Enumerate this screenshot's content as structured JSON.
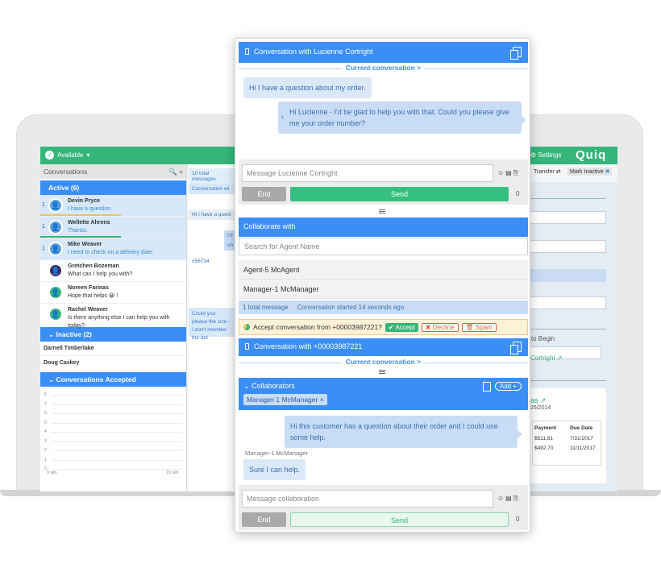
{
  "app": {
    "status": "Available",
    "settings": "Settings",
    "logo": "Quiq"
  },
  "left": {
    "conversations_title": "Conversations",
    "active_label": "Active (6)",
    "active": [
      {
        "num": "1",
        "name": "Devin Pryce",
        "msg": "I have a question",
        "style": "blue",
        "bar": "#f0c060"
      },
      {
        "num": "1",
        "name": "Wellette Ahrens",
        "msg": "Thanks.",
        "style": "blue",
        "bar": "#34b67a"
      },
      {
        "num": "1",
        "name": "Mike Weaver",
        "msg": "I need to check on a delivery date.",
        "style": "blue",
        "bar": ""
      },
      {
        "num": "",
        "name": "Gretchen Bozeman",
        "msg": "What can I help you with?",
        "style": "white",
        "bar": ""
      },
      {
        "num": "",
        "name": "Noreen Farinas",
        "msg": "Hope that helps 😀 !",
        "style": "white",
        "bar": ""
      },
      {
        "num": "",
        "name": "Rachel Weaver",
        "msg": "Is there anything else I can help you with today?",
        "style": "white",
        "bar": ""
      }
    ],
    "inactive_label": "Inactive (2)",
    "inactive": [
      "Darnell Timberlake",
      "Doug Caskey"
    ],
    "accepted_label": "Conversations Accepted",
    "chart_y": [
      "8",
      "7",
      "6",
      "5",
      "4",
      "3",
      "2",
      "1",
      "0"
    ],
    "chart_x": [
      "9 am",
      "10 am"
    ]
  },
  "mid": {
    "total": "10 total messages",
    "conv_with": "Conversation wi",
    "msg1": "Hi I have a quest",
    "msg2": "I'd",
    "msg3": "on",
    "order": "#56734",
    "msg4": "Could you please the size - I don't member the det"
  },
  "right": {
    "transfer": "Transfer",
    "mark_inactive": "Mark Inactive",
    "to_begin": "r to Begin",
    "cortright": "Cortright",
    "name_frag": "ias",
    "date_frag": "/25/2014",
    "payment_head": "Payment",
    "due_head": "Due Date",
    "rows": [
      [
        "$511.81",
        "7/31/2017"
      ],
      [
        "$492.70",
        "11/11/2017"
      ]
    ]
  },
  "widget": {
    "title": "Conversation with Lucienne Cortright",
    "current_conversation": "Current conversation >",
    "msg_customer": "Hi I have a question about my order.",
    "msg_agent": "Hi Lucienne - I'd be glad to help you with that. Could you please give me your order number?",
    "input_placeholder": "Message Lucienne Cortright",
    "end": "End",
    "send": "Send",
    "count": "0",
    "collaborate_with": "Collaborate with",
    "search_placeholder": "Search for Agent Name",
    "agents": [
      "Agent-5 McAgent",
      "Manager-1 McManager"
    ],
    "total_message": "1 total message",
    "started": "Conversation started 14 seconds ago",
    "accept_prompt": "Accept conversation from +00003987221?",
    "accept": "✔ Accept",
    "decline": "✖ Decline",
    "spam": "🗑 Spam",
    "conv2_title": "Conversation with +00003987221",
    "current_conversation2": "Current conversation >",
    "collaborators": "Collaborators",
    "add": "Add +",
    "collaborator_chip": "Manager-1 McManager ×",
    "collab_msg": "Hi this customer has a question about their order and I could use some help.",
    "collab_sender": "Manager-1 McManager",
    "collab_reply": "Sure I can help.",
    "collab_input_placeholder": "Message collaboration",
    "end2": "End",
    "send2": "Send",
    "count2": "0"
  }
}
